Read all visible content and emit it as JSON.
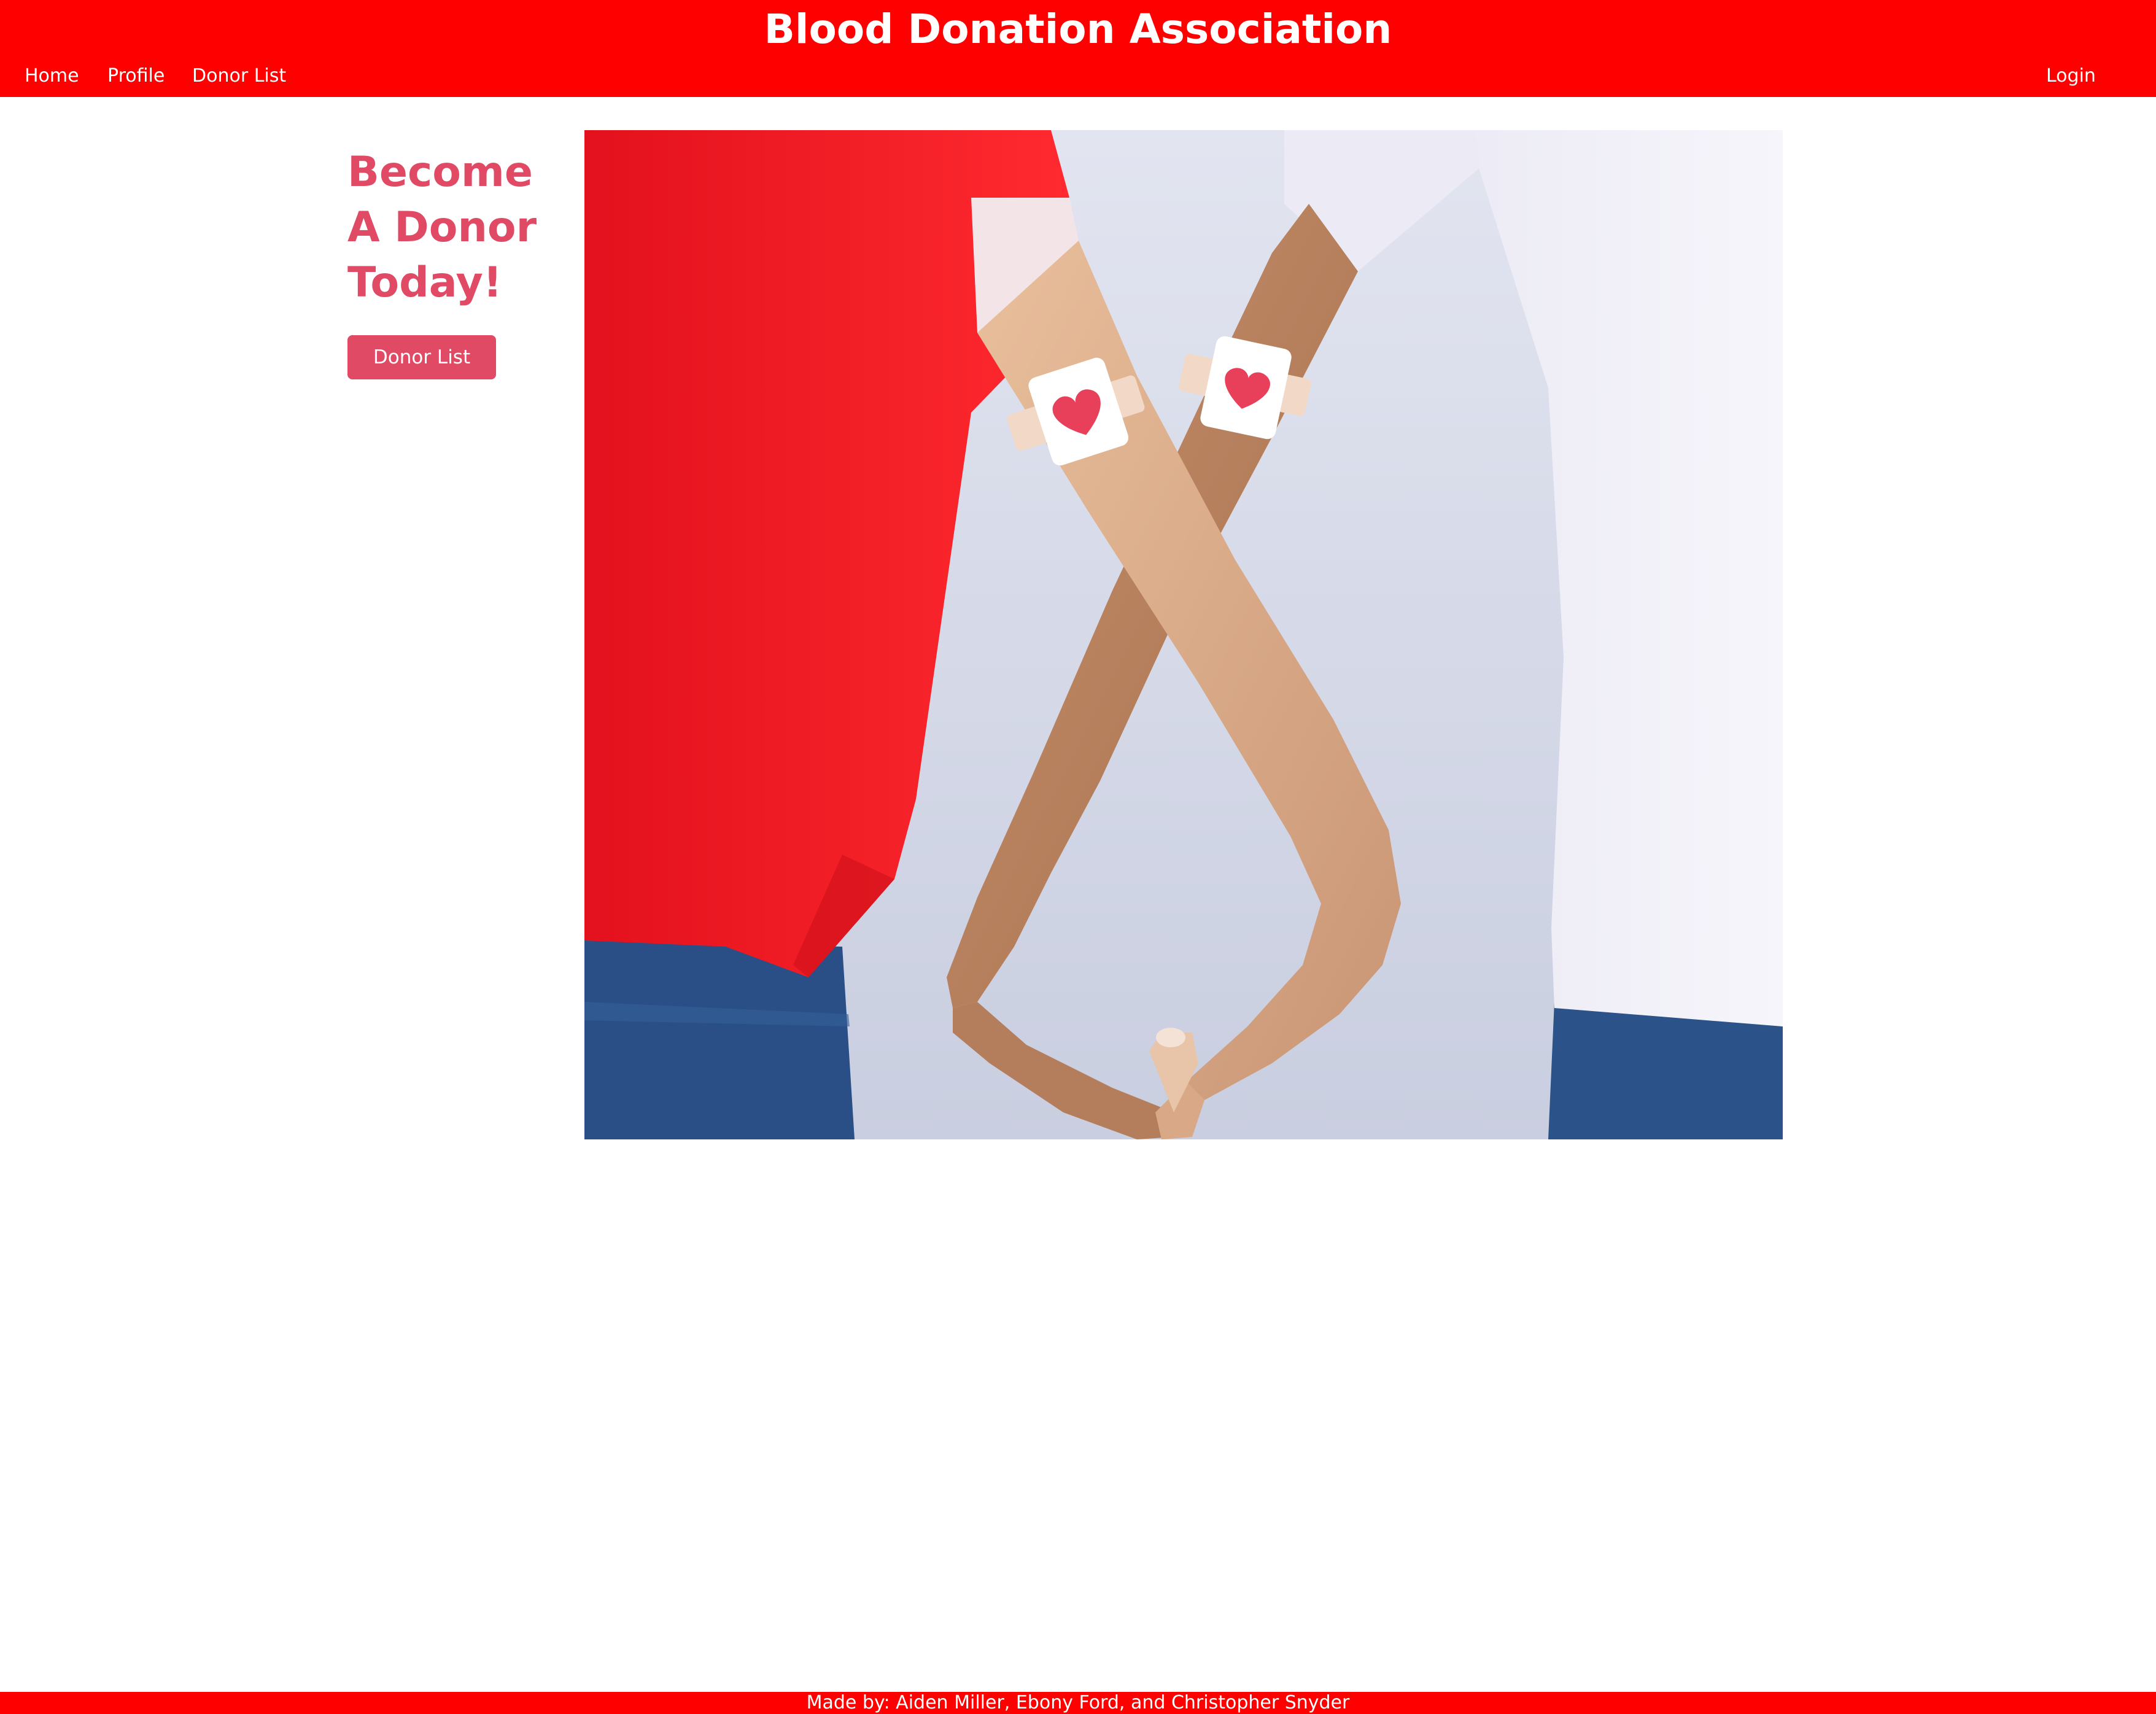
{
  "header": {
    "title": "Blood Donation Association",
    "nav": {
      "home": "Home",
      "profile": "Profile",
      "donor_list": "Donor List",
      "login": "Login"
    }
  },
  "hero": {
    "heading": "Become A Donor Today!",
    "button_label": "Donor List",
    "image_subject": "two-arms-with-heart-bandages-forming-heart-shape"
  },
  "footer": {
    "credits": "Made by: Aiden Miller, Ebony Ford, and Christopher Snyder"
  },
  "colors": {
    "brand_red": "#ff0000",
    "accent_pink": "#e04a64",
    "background": "#ffffff"
  }
}
